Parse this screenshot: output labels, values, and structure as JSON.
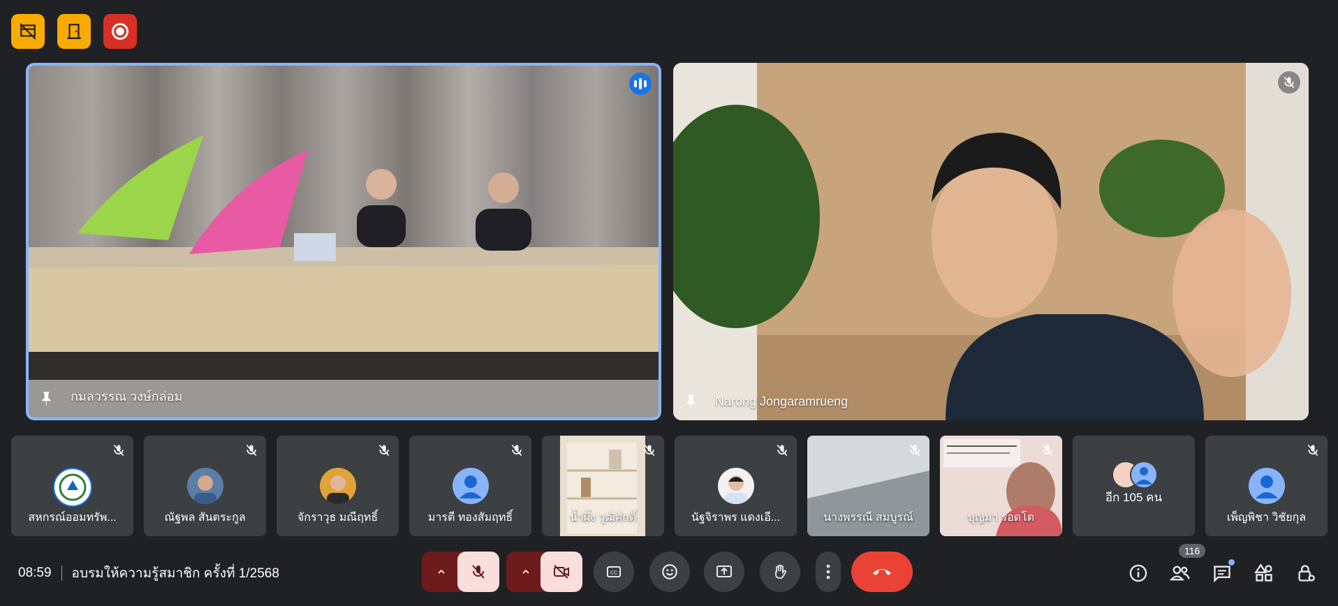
{
  "meeting": {
    "time": "08:59",
    "title": "อบรมให้ความรู้สมาชิก ครั้งที่ 1/2568"
  },
  "main_tiles": [
    {
      "name": "กมลวรรณ วงษ์กล่อม"
    },
    {
      "name": "Narong Jongaramrueng"
    }
  ],
  "participants": [
    {
      "name": "สหกรณ์ออมทรัพ..."
    },
    {
      "name": "ณัฐพล สันตระกูล"
    },
    {
      "name": "จักราวุธ มณีฤทธิ์"
    },
    {
      "name": "มารตี ทองสัมฤทธิ์"
    },
    {
      "name": "น้ำผึ้ง วุฒิศักดิ์"
    },
    {
      "name": "นัฐจิราพร แดงเอี..."
    },
    {
      "name": "นางพรรณี สมบูรณ์"
    },
    {
      "name": "บุญมา รอดโต"
    },
    {
      "name": "อีก 105 คน"
    },
    {
      "name": "เพ็ญพิชา วิชัยกุล"
    }
  ],
  "people_count": "116",
  "colors": {
    "accent": "#8ab4f8",
    "hangup": "#ea4335",
    "badge_yellow": "#f9ab00",
    "badge_red": "#d93025"
  },
  "icons": [
    "no-video-recording-icon",
    "door-icon",
    "record-icon",
    "pin-icon",
    "mic-off-icon",
    "camera-off-icon",
    "captions-icon",
    "emoji-icon",
    "present-icon",
    "hand-icon",
    "more-icon",
    "hangup-icon",
    "info-icon",
    "people-icon",
    "chat-icon",
    "activities-icon",
    "host-controls-icon",
    "speaking-icon"
  ]
}
